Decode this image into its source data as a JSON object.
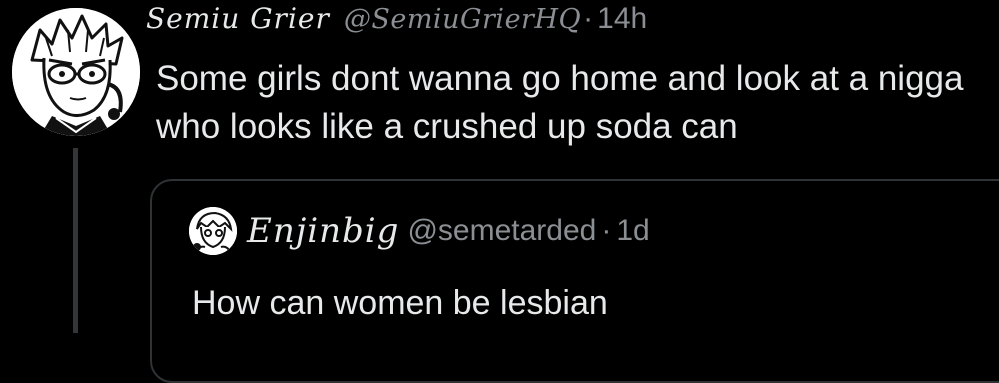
{
  "tweet": {
    "display_name": "Semiu Grier",
    "handle": "@SemiuGrierHQ",
    "separator": "·",
    "time": "14h",
    "text": "Some girls dont wanna go home and look at a nigga who looks like a crushed up soda can",
    "avatar_icon": "anime-character-avatar"
  },
  "quoted_tweet": {
    "display_name": "Enjinbig",
    "handle": "@semetarded",
    "separator": "·",
    "time": "1d",
    "text": "How can women be lesbian",
    "avatar_icon": "anime-character-avatar"
  },
  "colors": {
    "background": "#000000",
    "primary_text": "#e7e9ea",
    "secondary_text": "#8b8f94",
    "border": "#2f3336",
    "thread_line": "#333639"
  }
}
